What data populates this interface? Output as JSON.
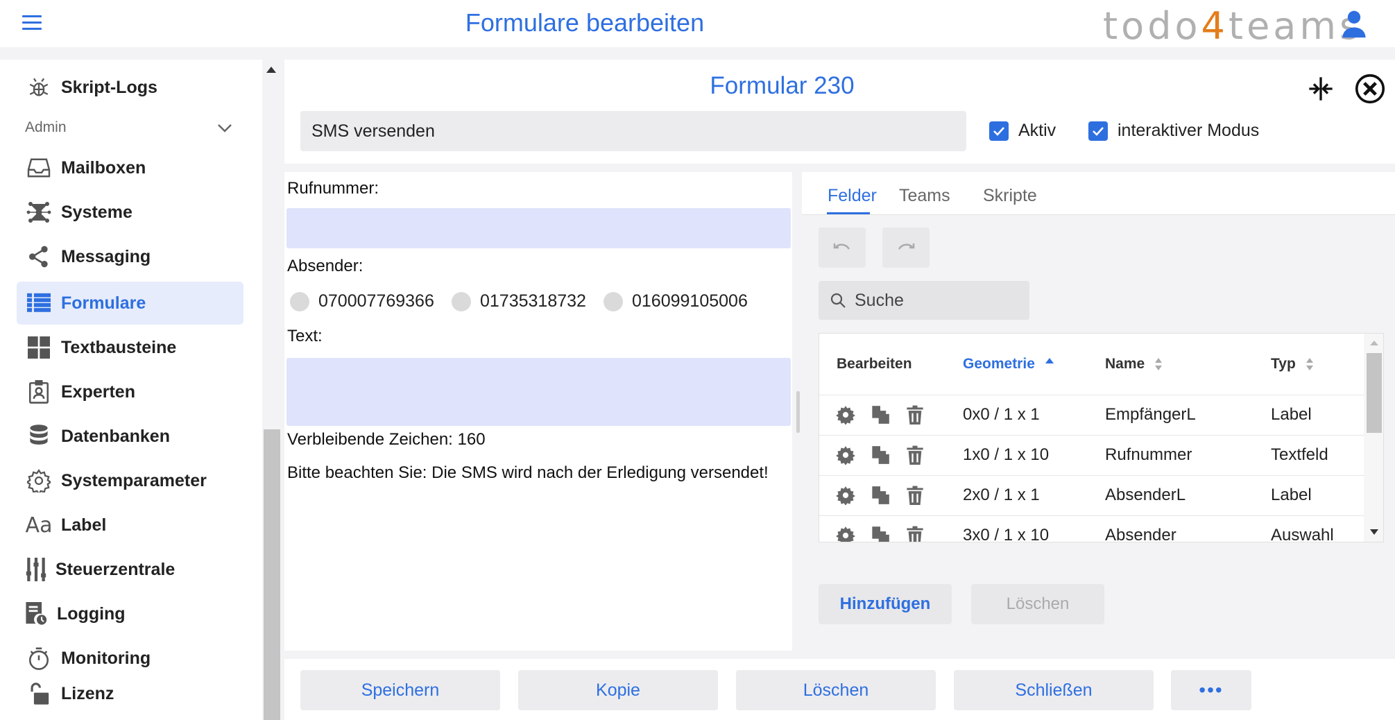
{
  "header": {
    "title": "Formulare bearbeiten",
    "logo_pre": "todo",
    "logo_four": "4",
    "logo_post": "teams",
    "accent_color": "#2e6fe0",
    "logo_accent_color": "#e37d1b"
  },
  "sidebar": {
    "top_item": {
      "label": "Skript-Logs",
      "icon": "bug-icon"
    },
    "section_label": "Admin",
    "items": [
      {
        "label": "Mailboxen",
        "icon": "inbox-icon"
      },
      {
        "label": "Systeme",
        "icon": "network-icon"
      },
      {
        "label": "Messaging",
        "icon": "share-icon"
      },
      {
        "label": "Formulare",
        "icon": "list-icon",
        "active": true
      },
      {
        "label": "Textbausteine",
        "icon": "grid-icon"
      },
      {
        "label": "Experten",
        "icon": "badge-icon"
      },
      {
        "label": "Datenbanken",
        "icon": "database-icon"
      },
      {
        "label": "Systemparameter",
        "icon": "gear-icon"
      },
      {
        "label": "Label",
        "icon": "font-icon"
      },
      {
        "label": "Steuerzentrale",
        "icon": "sliders-icon"
      },
      {
        "label": "Logging",
        "icon": "log-icon"
      },
      {
        "label": "Monitoring",
        "icon": "stopwatch-icon"
      },
      {
        "label": "Lizenz",
        "icon": "lock-open-icon"
      }
    ]
  },
  "form": {
    "title": "Formular 230",
    "name_value": "SMS versenden",
    "aktiv_label": "Aktiv",
    "aktiv_checked": true,
    "interactive_label": "interaktiver Modus",
    "interactive_checked": true
  },
  "preview": {
    "rufnummer_label": "Rufnummer:",
    "absender_label": "Absender:",
    "absender_options": [
      "070007769366",
      "01735318732",
      "016099105006"
    ],
    "text_label": "Text:",
    "remaining_label": "Verbleibende Zeichen:",
    "remaining_value": "160",
    "note": "Bitte beachten Sie: Die SMS wird nach der Erledigung versendet!"
  },
  "editor": {
    "tabs": [
      "Felder",
      "Teams",
      "Skripte"
    ],
    "active_tab": "Felder",
    "search_placeholder": "Suche",
    "columns": [
      "Bearbeiten",
      "Geometrie",
      "Name",
      "Typ"
    ],
    "sorted_column": "Geometrie",
    "rows": [
      {
        "geometrie": "0x0 / 1 x 1",
        "name": "EmpfängerL",
        "typ": "Label"
      },
      {
        "geometrie": "1x0 / 1 x 10",
        "name": "Rufnummer",
        "typ": "Textfeld"
      },
      {
        "geometrie": "2x0 / 1 x 1",
        "name": "AbsenderL",
        "typ": "Label"
      },
      {
        "geometrie": "3x0 / 1 x 10",
        "name": "Absender",
        "typ": "Auswahl"
      }
    ],
    "add_label": "Hinzufügen",
    "delete_label": "Löschen"
  },
  "footer": {
    "save": "Speichern",
    "copy": "Kopie",
    "delete": "Löschen",
    "close": "Schließen",
    "more": "•••"
  }
}
